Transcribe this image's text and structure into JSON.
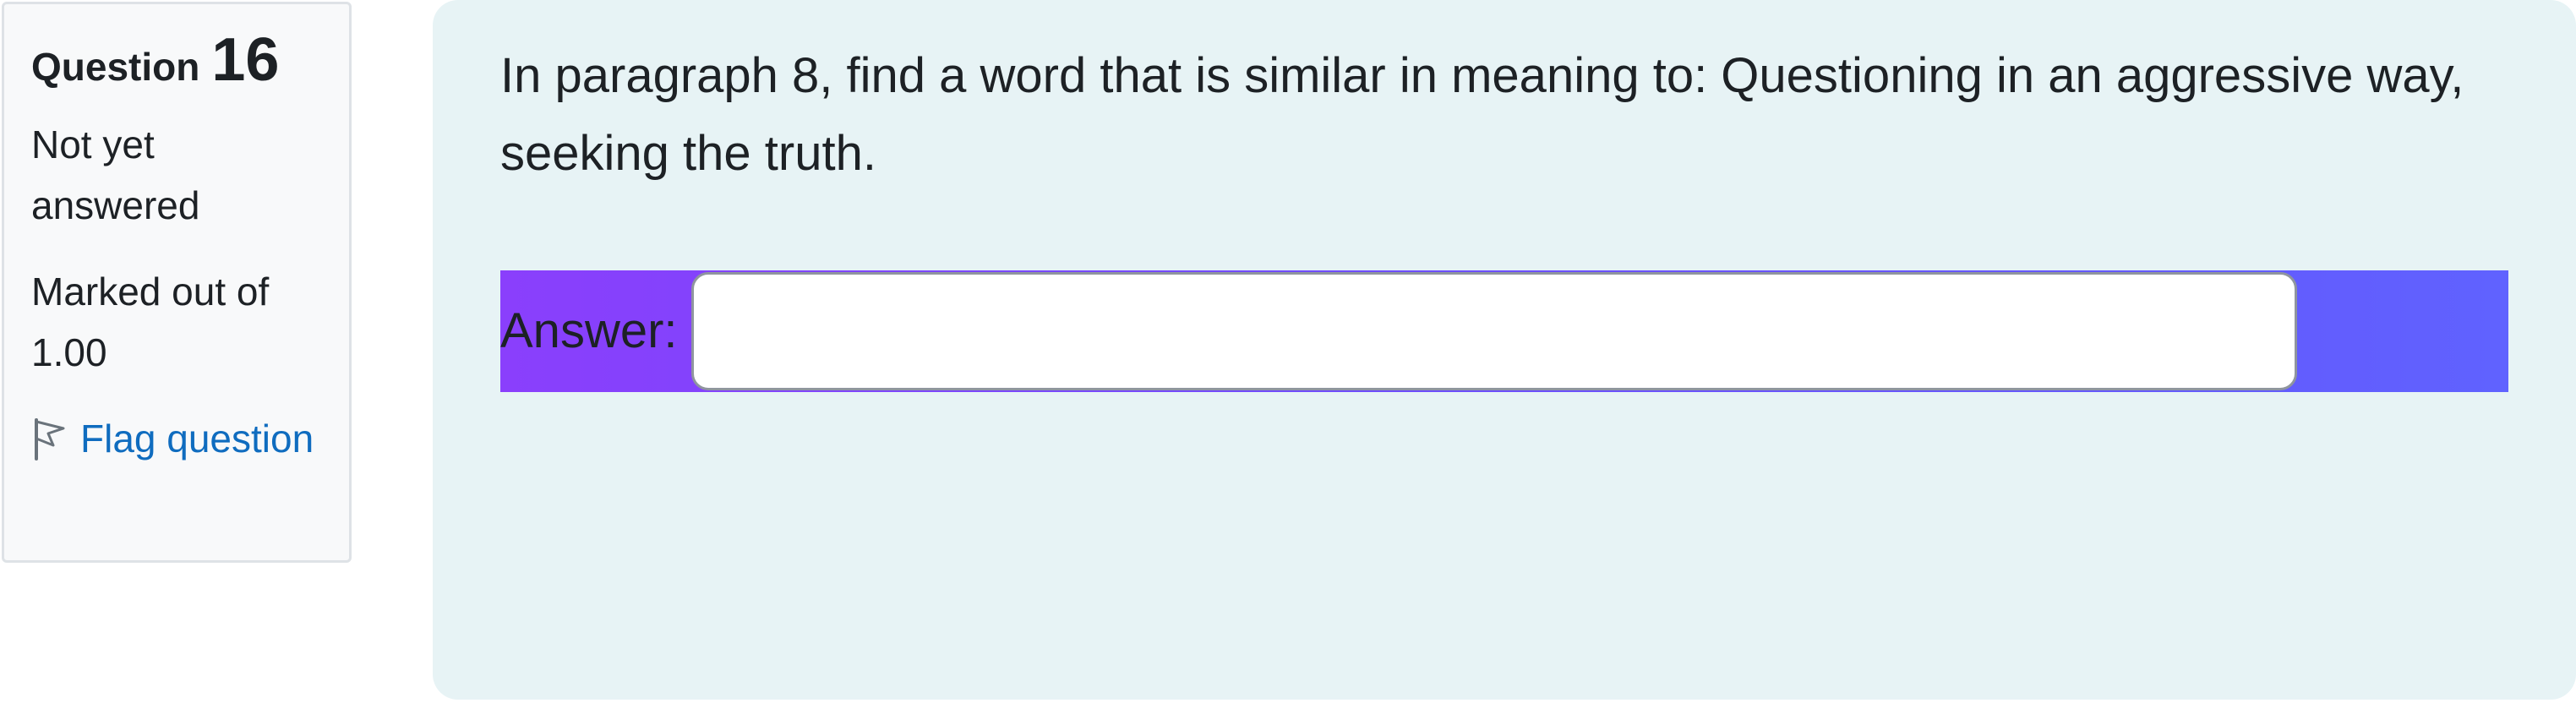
{
  "question_info": {
    "heading_prefix": "Question",
    "number": "16",
    "status": "Not yet answered",
    "marks": "Marked out of 1.00",
    "flag_label": "Flag question"
  },
  "question": {
    "text": "In paragraph 8, find a word that is similar in meaning to: Questioning in an aggressive way, seeking the truth.",
    "answer_label": "Answer:",
    "answer_value": ""
  },
  "icons": {
    "flag": "flag-outline-icon"
  },
  "colors": {
    "info_panel_bg": "#f8f9fa",
    "content_panel_bg": "#e7f3f5",
    "link": "#0f6cbf",
    "answer_row_gradient_start": "#8a3ffc",
    "answer_row_gradient_end": "#6062ff"
  }
}
